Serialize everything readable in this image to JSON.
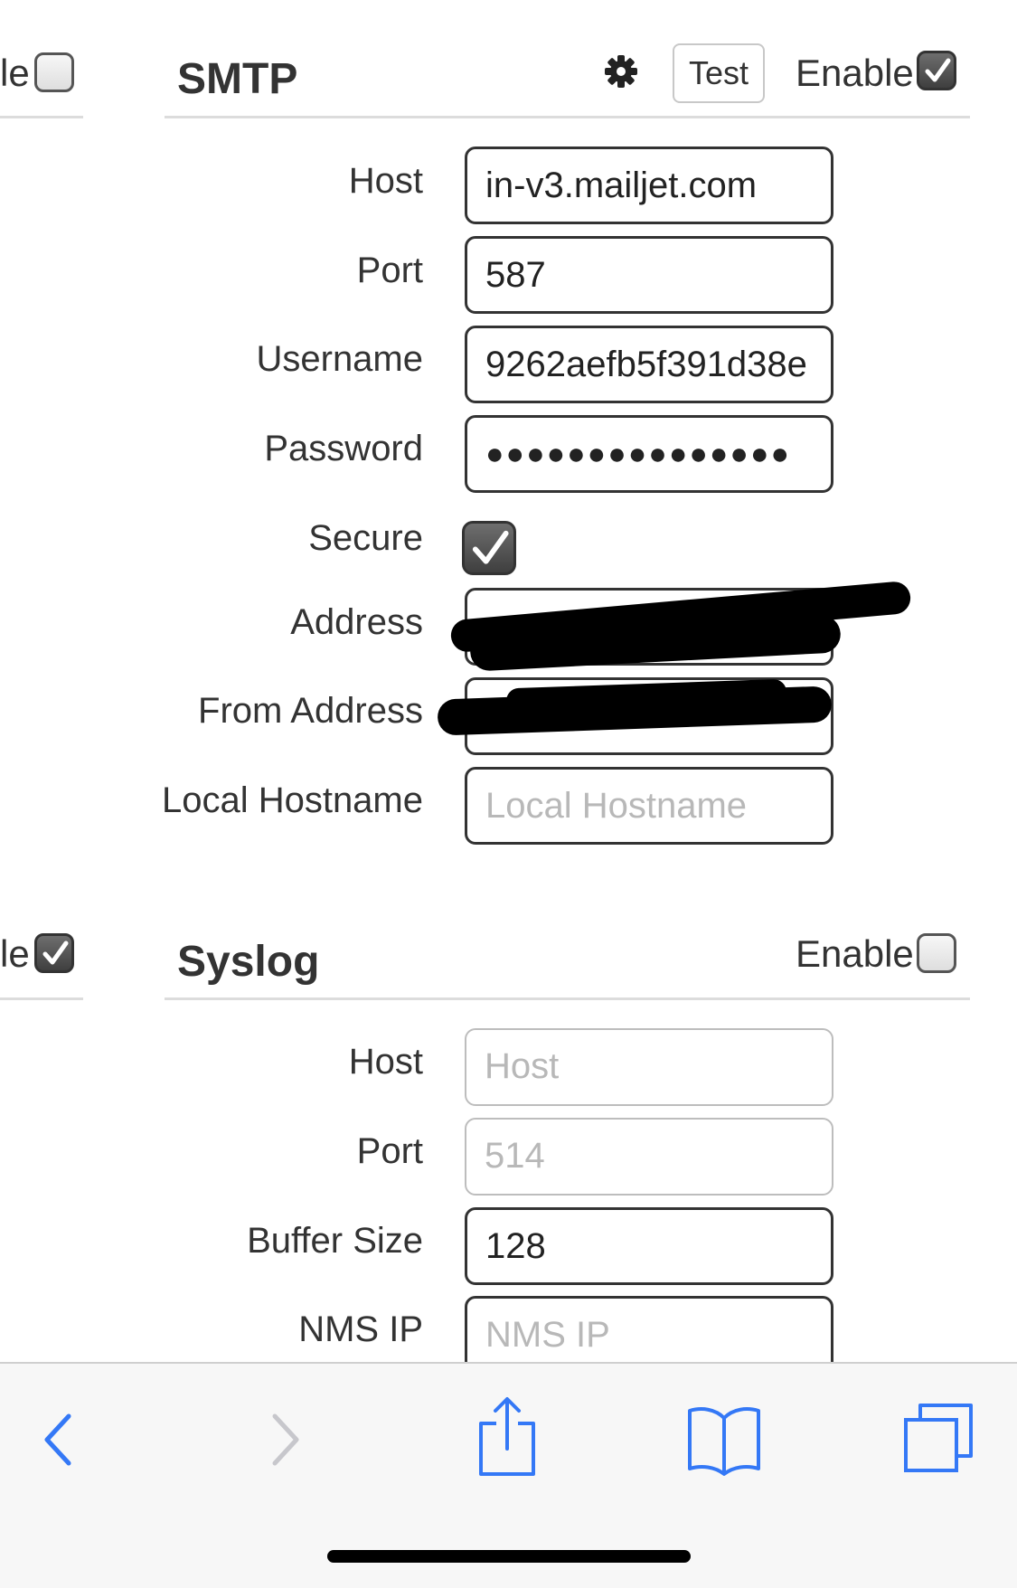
{
  "left_column": {
    "top_label": "le",
    "bottom_label": "le",
    "top_checked": false,
    "bottom_checked": true
  },
  "smtp": {
    "title": "SMTP",
    "test_label": "Test",
    "enable_label": "Enable",
    "enabled": true,
    "fields": {
      "host": {
        "label": "Host",
        "value": "in-v3.mailjet.com"
      },
      "port": {
        "label": "Port",
        "value": "587"
      },
      "username": {
        "label": "Username",
        "value": "9262aefb5f391d38e"
      },
      "password": {
        "label": "Password",
        "value": "●●●●●●●●●●●●●●●"
      },
      "secure": {
        "label": "Secure",
        "checked": true
      },
      "address": {
        "label": "Address"
      },
      "from_address": {
        "label": "From Address"
      },
      "local_hostname": {
        "label": "Local Hostname",
        "placeholder": "Local Hostname"
      }
    }
  },
  "syslog": {
    "title": "Syslog",
    "enable_label": "Enable",
    "enabled": false,
    "fields": {
      "host": {
        "label": "Host",
        "placeholder": "Host"
      },
      "port": {
        "label": "Port",
        "placeholder": "514"
      },
      "buffer_size": {
        "label": "Buffer Size",
        "value": "128"
      },
      "nms_ip": {
        "label": "NMS IP",
        "placeholder": "NMS IP"
      }
    }
  },
  "toolbar": {
    "icons": [
      "back-icon",
      "forward-icon",
      "share-icon",
      "bookmarks-icon",
      "tabs-icon"
    ],
    "accent": "#3478f6",
    "disabled": "#c7c7cc"
  }
}
